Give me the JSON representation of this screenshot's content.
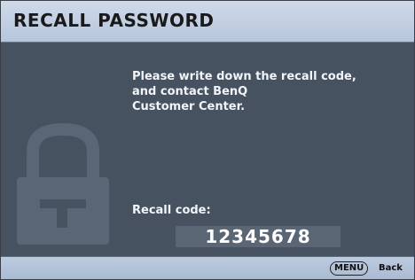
{
  "dialog": {
    "title": "RECALL PASSWORD"
  },
  "message": {
    "lines": [
      "Please write down the recall code,",
      "and contact BenQ",
      "Customer Center."
    ]
  },
  "recall": {
    "label": "Recall code:",
    "code": "12345678"
  },
  "footer": {
    "menu_key": "MENU",
    "back_label": "Back"
  },
  "icons": {
    "lock": "lock-icon"
  },
  "colors": {
    "panel_bg": "#46525f",
    "title_bar": "#c5d2e6",
    "code_box": "#5b6674",
    "text": "#f1f4f8"
  }
}
